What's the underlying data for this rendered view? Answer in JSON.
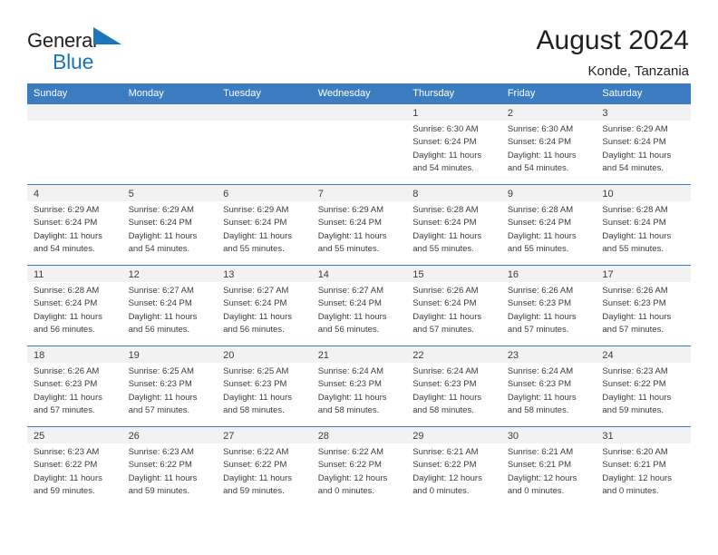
{
  "logo": {
    "word1": "General",
    "word2": "Blue",
    "triangle_color": "#1b75bb",
    "icon": "triangle-flag-icon"
  },
  "header": {
    "title": "August 2024",
    "subtitle": "Konde, Tanzania"
  },
  "theme": {
    "header_bg": "#3b7dc0",
    "daynum_bg": "#f2f2f2",
    "text": "#3c3c3c"
  },
  "weekdays": [
    "Sunday",
    "Monday",
    "Tuesday",
    "Wednesday",
    "Thursday",
    "Friday",
    "Saturday"
  ],
  "labels": {
    "sunrise": "Sunrise:",
    "sunset": "Sunset:",
    "daylight": "Daylight:"
  },
  "weeks": [
    [
      {
        "day": "",
        "empty": true
      },
      {
        "day": "",
        "empty": true
      },
      {
        "day": "",
        "empty": true
      },
      {
        "day": "",
        "empty": true
      },
      {
        "day": "1",
        "sunrise": "Sunrise: 6:30 AM",
        "sunset": "Sunset: 6:24 PM",
        "daylight1": "Daylight: 11 hours",
        "daylight2": "and 54 minutes."
      },
      {
        "day": "2",
        "sunrise": "Sunrise: 6:30 AM",
        "sunset": "Sunset: 6:24 PM",
        "daylight1": "Daylight: 11 hours",
        "daylight2": "and 54 minutes."
      },
      {
        "day": "3",
        "sunrise": "Sunrise: 6:29 AM",
        "sunset": "Sunset: 6:24 PM",
        "daylight1": "Daylight: 11 hours",
        "daylight2": "and 54 minutes."
      }
    ],
    [
      {
        "day": "4",
        "sunrise": "Sunrise: 6:29 AM",
        "sunset": "Sunset: 6:24 PM",
        "daylight1": "Daylight: 11 hours",
        "daylight2": "and 54 minutes."
      },
      {
        "day": "5",
        "sunrise": "Sunrise: 6:29 AM",
        "sunset": "Sunset: 6:24 PM",
        "daylight1": "Daylight: 11 hours",
        "daylight2": "and 54 minutes."
      },
      {
        "day": "6",
        "sunrise": "Sunrise: 6:29 AM",
        "sunset": "Sunset: 6:24 PM",
        "daylight1": "Daylight: 11 hours",
        "daylight2": "and 55 minutes."
      },
      {
        "day": "7",
        "sunrise": "Sunrise: 6:29 AM",
        "sunset": "Sunset: 6:24 PM",
        "daylight1": "Daylight: 11 hours",
        "daylight2": "and 55 minutes."
      },
      {
        "day": "8",
        "sunrise": "Sunrise: 6:28 AM",
        "sunset": "Sunset: 6:24 PM",
        "daylight1": "Daylight: 11 hours",
        "daylight2": "and 55 minutes."
      },
      {
        "day": "9",
        "sunrise": "Sunrise: 6:28 AM",
        "sunset": "Sunset: 6:24 PM",
        "daylight1": "Daylight: 11 hours",
        "daylight2": "and 55 minutes."
      },
      {
        "day": "10",
        "sunrise": "Sunrise: 6:28 AM",
        "sunset": "Sunset: 6:24 PM",
        "daylight1": "Daylight: 11 hours",
        "daylight2": "and 55 minutes."
      }
    ],
    [
      {
        "day": "11",
        "sunrise": "Sunrise: 6:28 AM",
        "sunset": "Sunset: 6:24 PM",
        "daylight1": "Daylight: 11 hours",
        "daylight2": "and 56 minutes."
      },
      {
        "day": "12",
        "sunrise": "Sunrise: 6:27 AM",
        "sunset": "Sunset: 6:24 PM",
        "daylight1": "Daylight: 11 hours",
        "daylight2": "and 56 minutes."
      },
      {
        "day": "13",
        "sunrise": "Sunrise: 6:27 AM",
        "sunset": "Sunset: 6:24 PM",
        "daylight1": "Daylight: 11 hours",
        "daylight2": "and 56 minutes."
      },
      {
        "day": "14",
        "sunrise": "Sunrise: 6:27 AM",
        "sunset": "Sunset: 6:24 PM",
        "daylight1": "Daylight: 11 hours",
        "daylight2": "and 56 minutes."
      },
      {
        "day": "15",
        "sunrise": "Sunrise: 6:26 AM",
        "sunset": "Sunset: 6:24 PM",
        "daylight1": "Daylight: 11 hours",
        "daylight2": "and 57 minutes."
      },
      {
        "day": "16",
        "sunrise": "Sunrise: 6:26 AM",
        "sunset": "Sunset: 6:23 PM",
        "daylight1": "Daylight: 11 hours",
        "daylight2": "and 57 minutes."
      },
      {
        "day": "17",
        "sunrise": "Sunrise: 6:26 AM",
        "sunset": "Sunset: 6:23 PM",
        "daylight1": "Daylight: 11 hours",
        "daylight2": "and 57 minutes."
      }
    ],
    [
      {
        "day": "18",
        "sunrise": "Sunrise: 6:26 AM",
        "sunset": "Sunset: 6:23 PM",
        "daylight1": "Daylight: 11 hours",
        "daylight2": "and 57 minutes."
      },
      {
        "day": "19",
        "sunrise": "Sunrise: 6:25 AM",
        "sunset": "Sunset: 6:23 PM",
        "daylight1": "Daylight: 11 hours",
        "daylight2": "and 57 minutes."
      },
      {
        "day": "20",
        "sunrise": "Sunrise: 6:25 AM",
        "sunset": "Sunset: 6:23 PM",
        "daylight1": "Daylight: 11 hours",
        "daylight2": "and 58 minutes."
      },
      {
        "day": "21",
        "sunrise": "Sunrise: 6:24 AM",
        "sunset": "Sunset: 6:23 PM",
        "daylight1": "Daylight: 11 hours",
        "daylight2": "and 58 minutes."
      },
      {
        "day": "22",
        "sunrise": "Sunrise: 6:24 AM",
        "sunset": "Sunset: 6:23 PM",
        "daylight1": "Daylight: 11 hours",
        "daylight2": "and 58 minutes."
      },
      {
        "day": "23",
        "sunrise": "Sunrise: 6:24 AM",
        "sunset": "Sunset: 6:23 PM",
        "daylight1": "Daylight: 11 hours",
        "daylight2": "and 58 minutes."
      },
      {
        "day": "24",
        "sunrise": "Sunrise: 6:23 AM",
        "sunset": "Sunset: 6:22 PM",
        "daylight1": "Daylight: 11 hours",
        "daylight2": "and 59 minutes."
      }
    ],
    [
      {
        "day": "25",
        "sunrise": "Sunrise: 6:23 AM",
        "sunset": "Sunset: 6:22 PM",
        "daylight1": "Daylight: 11 hours",
        "daylight2": "and 59 minutes."
      },
      {
        "day": "26",
        "sunrise": "Sunrise: 6:23 AM",
        "sunset": "Sunset: 6:22 PM",
        "daylight1": "Daylight: 11 hours",
        "daylight2": "and 59 minutes."
      },
      {
        "day": "27",
        "sunrise": "Sunrise: 6:22 AM",
        "sunset": "Sunset: 6:22 PM",
        "daylight1": "Daylight: 11 hours",
        "daylight2": "and 59 minutes."
      },
      {
        "day": "28",
        "sunrise": "Sunrise: 6:22 AM",
        "sunset": "Sunset: 6:22 PM",
        "daylight1": "Daylight: 12 hours",
        "daylight2": "and 0 minutes."
      },
      {
        "day": "29",
        "sunrise": "Sunrise: 6:21 AM",
        "sunset": "Sunset: 6:22 PM",
        "daylight1": "Daylight: 12 hours",
        "daylight2": "and 0 minutes."
      },
      {
        "day": "30",
        "sunrise": "Sunrise: 6:21 AM",
        "sunset": "Sunset: 6:21 PM",
        "daylight1": "Daylight: 12 hours",
        "daylight2": "and 0 minutes."
      },
      {
        "day": "31",
        "sunrise": "Sunrise: 6:20 AM",
        "sunset": "Sunset: 6:21 PM",
        "daylight1": "Daylight: 12 hours",
        "daylight2": "and 0 minutes."
      }
    ]
  ]
}
